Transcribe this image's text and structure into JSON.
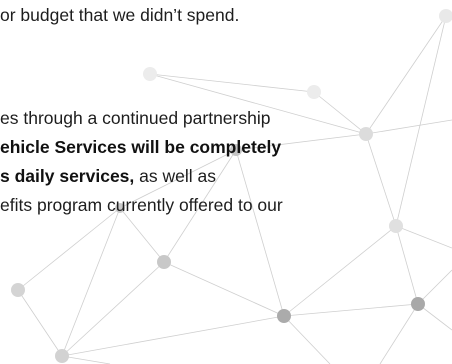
{
  "document": {
    "line_top": "or budget that we didn’t spend.",
    "para": {
      "line1": "es through a continued partnership",
      "line2_bold": "ehicle Services will be completely",
      "line3_bold": "s daily services,",
      "line3_rest": " as well as",
      "line4": "efits program currently offered to our"
    }
  },
  "decoration": {
    "network_line_color": "#cfcfcf",
    "node_colors": [
      "#e9e9e9",
      "#dcdcdc",
      "#c4c4c4",
      "#a9a9a9"
    ]
  }
}
